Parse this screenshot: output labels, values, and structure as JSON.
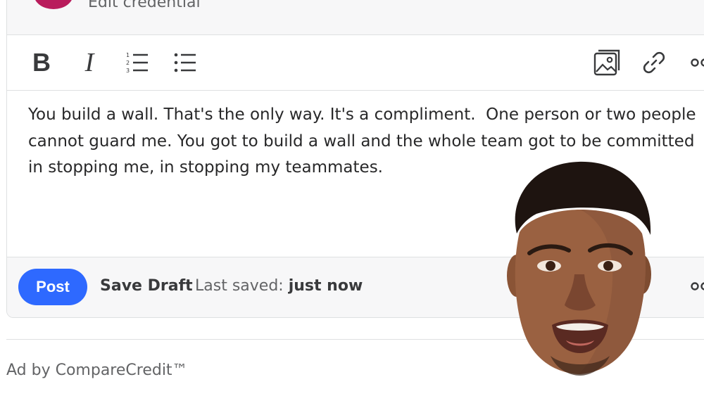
{
  "header": {
    "edit_credential_label": "Edit credential"
  },
  "toolbar": {
    "bold_label": "B",
    "italic_label": "I",
    "icons": [
      "bold-icon",
      "italic-icon",
      "numbered-list-icon",
      "bulleted-list-icon",
      "image-icon",
      "link-icon",
      "more-icon"
    ]
  },
  "editor": {
    "text": "You build a wall. That's the only way. It's a compliment.  One person or two people cannot guard me. You got to build a wall and the whole team got to be committed in stopping me, in stopping my teammates."
  },
  "footer": {
    "post_label": "Post",
    "save_draft_label": "Save Draft",
    "last_saved_prefix": "Last saved:",
    "last_saved_value": "just now"
  },
  "ad": {
    "label": "Ad by CompareCredit™"
  },
  "colors": {
    "accent": "#2e69ff",
    "avatar": "#b91c5c",
    "text": "#282829",
    "muted": "#636466",
    "border": "#dee0e1"
  }
}
